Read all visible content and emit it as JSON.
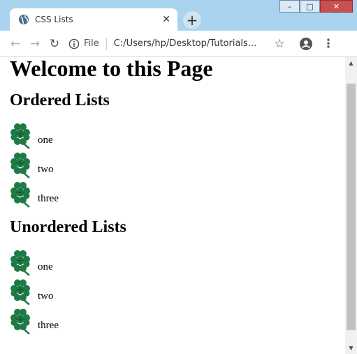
{
  "window": {
    "minimize": "–",
    "maximize": "□",
    "close": "✕"
  },
  "tab": {
    "title": "CSS Lists",
    "close": "✕",
    "new_tab": "+"
  },
  "toolbar": {
    "back": "←",
    "forward": "→",
    "reload": "↻",
    "file_label": "File",
    "url": "C:/Users/hp/Desktop/Tutorials...",
    "star": "☆",
    "menu": "⋮"
  },
  "page": {
    "heading": "Welcome to this Page",
    "ordered": {
      "heading": "Ordered Lists",
      "items": [
        "one",
        "two",
        "three"
      ]
    },
    "unordered": {
      "heading": "Unordered Lists",
      "items": [
        "one",
        "two",
        "three"
      ]
    }
  },
  "colors": {
    "clover": "#1e7a45"
  }
}
